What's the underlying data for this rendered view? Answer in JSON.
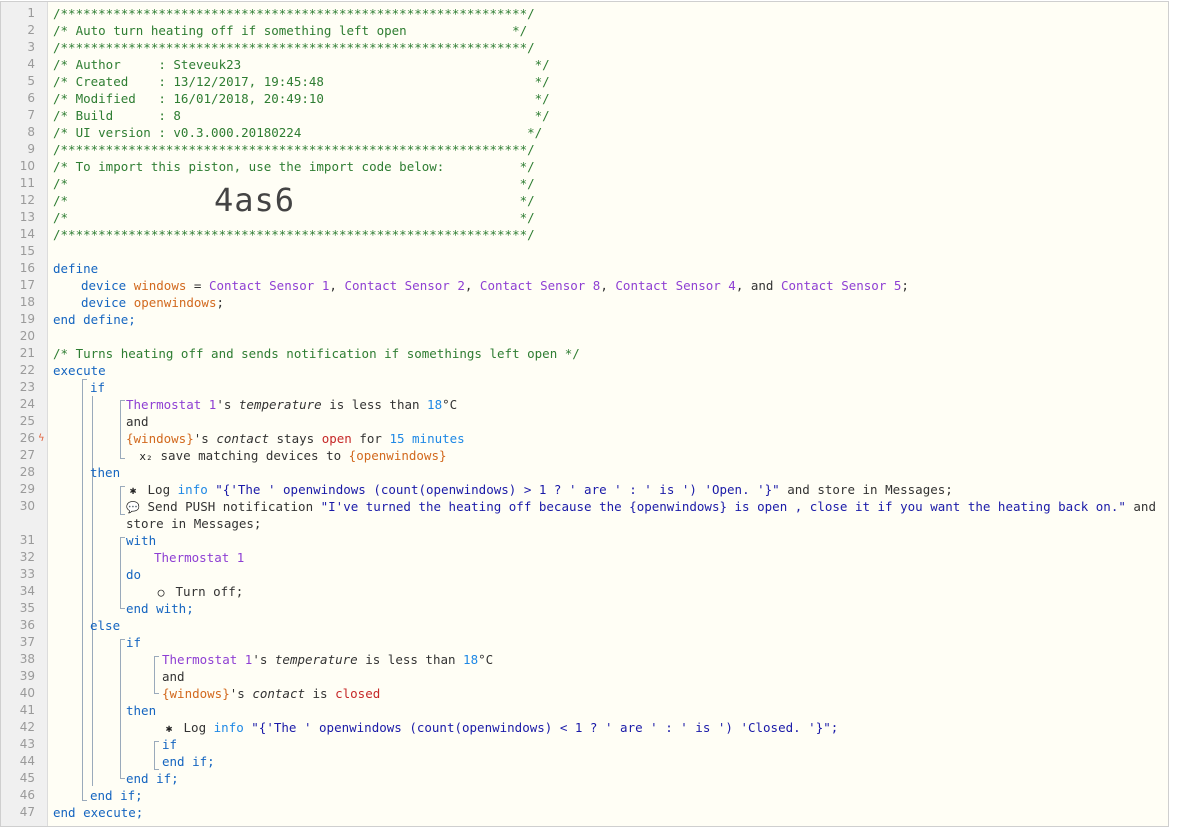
{
  "header": {
    "stars": "/**************************************************************/",
    "title": "/* Auto turn heating off if something left open              */",
    "author": "/* Author     : Steveuk23                                       */",
    "created": "/* Created    : 13/12/2017, 19:45:48                            */",
    "modified": "/* Modified   : 16/01/2018, 20:49:10                            */",
    "build": "/* Build      : 8                                               */",
    "ui_version": "/* UI version : v0.3.000.20180224                              */",
    "import_note": "/* To import this piston, use the import code below:          */",
    "blank": "/*                                                            */",
    "import_code": "4as6"
  },
  "define": {
    "kw": "define",
    "device_kw": "device",
    "var1": "windows",
    "eq": " = ",
    "sensors": [
      "Contact Sensor 1",
      "Contact Sensor 2",
      "Contact Sensor 8",
      "Contact Sensor 4",
      "Contact Sensor 5"
    ],
    "and": ", and ",
    "var2": "openwindows",
    "end": "end define;"
  },
  "comment": "/* Turns heating off and sends notification if somethings left open */",
  "execute": {
    "kw": "execute",
    "if": "if",
    "thermostat": "Thermostat 1",
    "poss": "'s ",
    "temperature": "temperature",
    "less": " is less than ",
    "temp_val": "18",
    "unit": "°C",
    "and": "and",
    "windows_ref": "{windows}",
    "contact": "contact",
    "stays": " stays ",
    "open": "open",
    "for": " for ",
    "duration": "15 minutes",
    "save_text": " save matching devices to ",
    "save_var": "{openwindows}",
    "then": "then",
    "log": " Log ",
    "info": "info",
    "log1_str": "\"{'The ' openwindows (count(openwindows) > 1 ? ' are ' : ' is ') 'Open. '}\"",
    "log1_tail": " and store in Messages;",
    "push": " Send PUSH notification ",
    "push_str": "\"I've turned the heating off because the {openwindows} is open , close it if you want the heating back on.\"",
    "push_tail": " and",
    "push_tail2": "store in Messages;",
    "with": "with",
    "do": "do",
    "turn_off": " Turn off;",
    "end_with": "end with;",
    "else": "else",
    "is": " is ",
    "closed": "closed",
    "log2_str": "\"{'The ' openwindows (count(openwindows) < 1 ? ' are ' : ' is ') 'Closed. '}\";",
    "end_if": "end if;",
    "end_execute": "end execute;"
  },
  "line_numbers": [
    "1",
    "2",
    "3",
    "4",
    "5",
    "6",
    "7",
    "8",
    "9",
    "10",
    "11",
    "12",
    "13",
    "14",
    "15",
    "16",
    "17",
    "18",
    "19",
    "20",
    "21",
    "22",
    "23",
    "24",
    "25",
    "26",
    "27",
    "28",
    "29",
    "30",
    "31",
    "32",
    "33",
    "34",
    "35",
    "36",
    "37",
    "38",
    "39",
    "40",
    "41",
    "42",
    "43",
    "44",
    "45",
    "46",
    "47"
  ],
  "colors": {
    "comment": "#2e7d32",
    "keyword": "#1565c0",
    "device": "#8e3fd3",
    "variable": "#d2691e",
    "number": "#1e88e5",
    "string": "#1a1aa8",
    "red": "#c62828"
  },
  "icons": {
    "bolt": "lightning-icon",
    "bug": "bug-icon",
    "chat": "chat-bubble-icon",
    "power": "power-icon",
    "x2": "x2-icon"
  },
  "icon_glyphs": {
    "bolt": "ϟ",
    "bug": "✱",
    "chat": "💬",
    "power": "◯",
    "x2": "x₂"
  }
}
